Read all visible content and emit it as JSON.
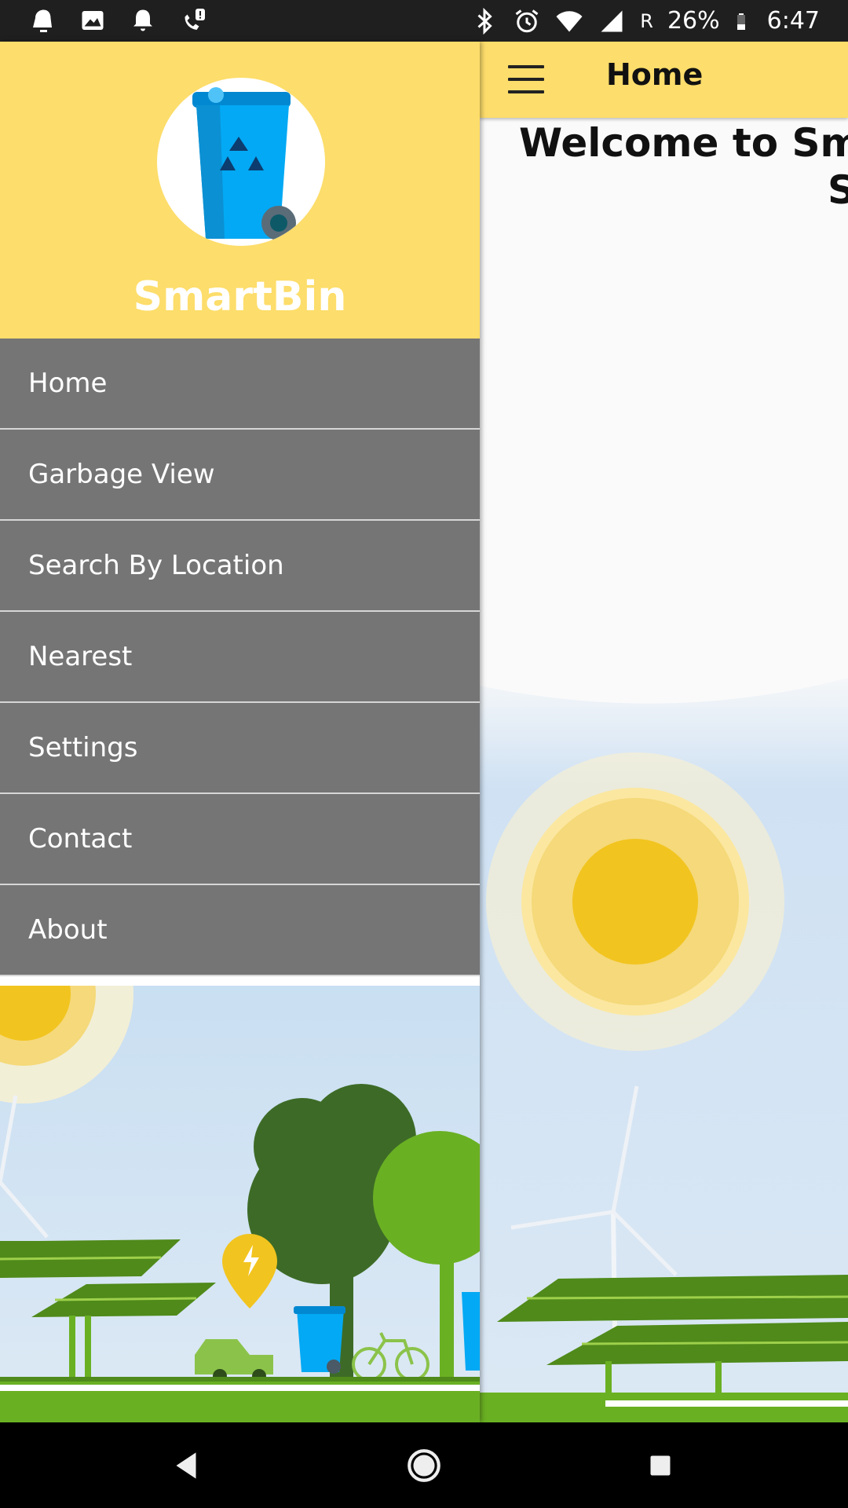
{
  "status_bar": {
    "battery": "26%",
    "time": "6:47",
    "network_label": "R"
  },
  "app_bar": {
    "title": "Home"
  },
  "main": {
    "welcome_line1": "Welcome to Smar",
    "welcome_line2": "S"
  },
  "drawer": {
    "app_name": "SmartBin",
    "menu": [
      {
        "label": "Home"
      },
      {
        "label": "Garbage View"
      },
      {
        "label": "Search By Location"
      },
      {
        "label": "Nearest"
      },
      {
        "label": "Settings"
      },
      {
        "label": "Contact"
      },
      {
        "label": "About"
      }
    ]
  },
  "colors": {
    "header_yellow": "#fddd6b",
    "menu_gray": "#757575",
    "bin_blue": "#03a9f4",
    "grass_green": "#6ab023"
  }
}
